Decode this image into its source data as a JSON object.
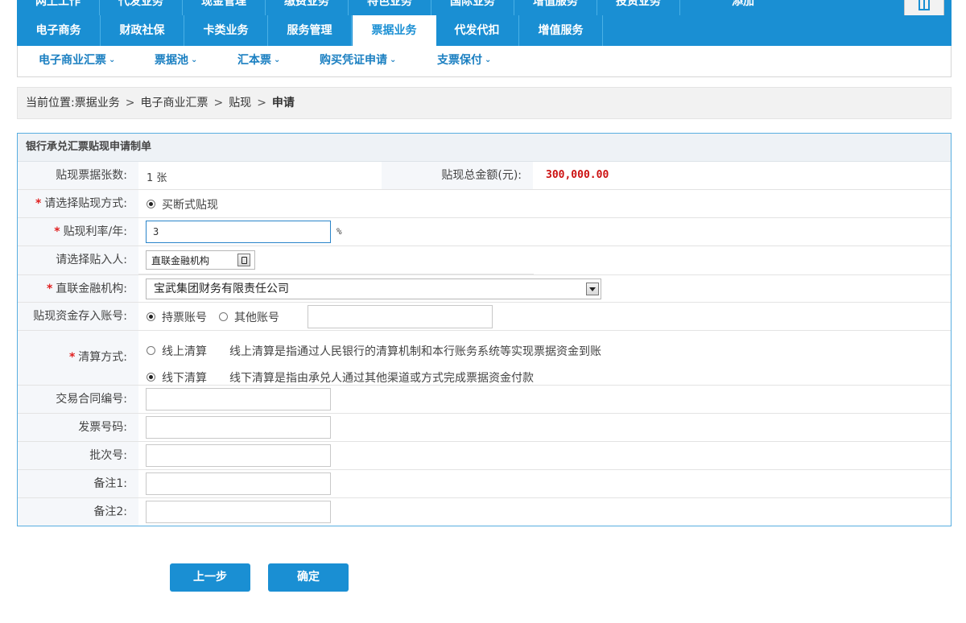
{
  "nav_top": {
    "tabs": [
      "网上工作",
      "代发业务",
      "现金管理",
      "缴费业务",
      "特色业务",
      "国际业务",
      "增值服务",
      "投资业务"
    ],
    "add_label": "添加"
  },
  "nav_main": {
    "tabs": [
      {
        "label": "电子商务"
      },
      {
        "label": "财政社保"
      },
      {
        "label": "卡类业务"
      },
      {
        "label": "服务管理"
      },
      {
        "label": "票据业务",
        "active": true
      },
      {
        "label": "代发代扣"
      },
      {
        "label": "增值服务"
      }
    ]
  },
  "sub_nav": [
    "电子商业汇票",
    "票据池",
    "汇本票",
    "购买凭证申请",
    "支票保付"
  ],
  "breadcrumb": {
    "prefix": "当前位置:",
    "items": [
      "票据业务",
      "电子商业汇票",
      "贴现"
    ],
    "current": "申请",
    "separator": ">"
  },
  "form": {
    "title": "银行承兑汇票贴现申请制单",
    "count_label": "贴现票据张数:",
    "count_value": "1 张",
    "total_label": "贴现总金额(元):",
    "total_value": "300,000.00",
    "mode_label": "请选择贴现方式:",
    "mode_option": "买断式贴现",
    "rate_label": "贴现利率/年:",
    "rate_value": "3",
    "rate_unit": "%",
    "payee_label": "请选择贴入人:",
    "payee_value": "直联金融机构",
    "inst_label": "直联金融机构:",
    "inst_value": "宝武集团财务有限责任公司",
    "account_label": "贴现资金存入账号:",
    "account_opt1": "持票账号",
    "account_opt2": "其他账号",
    "clearing_label": "清算方式:",
    "clearing_opt1": "线上清算",
    "clearing_desc1": "线上清算是指通过人民银行的清算机制和本行账务系统等实现票据资金到账",
    "clearing_opt2": "线下清算",
    "clearing_desc2": "线下清算是指由承兑人通过其他渠道或方式完成票据资金付款",
    "contract_label": "交易合同编号:",
    "invoice_label": "发票号码:",
    "batch_label": "批次号:",
    "note1_label": "备注1:",
    "note2_label": "备注2:"
  },
  "buttons": {
    "prev": "上一步",
    "confirm": "确定"
  },
  "colors": {
    "accent": "#1a8fd3",
    "amount": "#cc1111",
    "required": "#e02020"
  }
}
